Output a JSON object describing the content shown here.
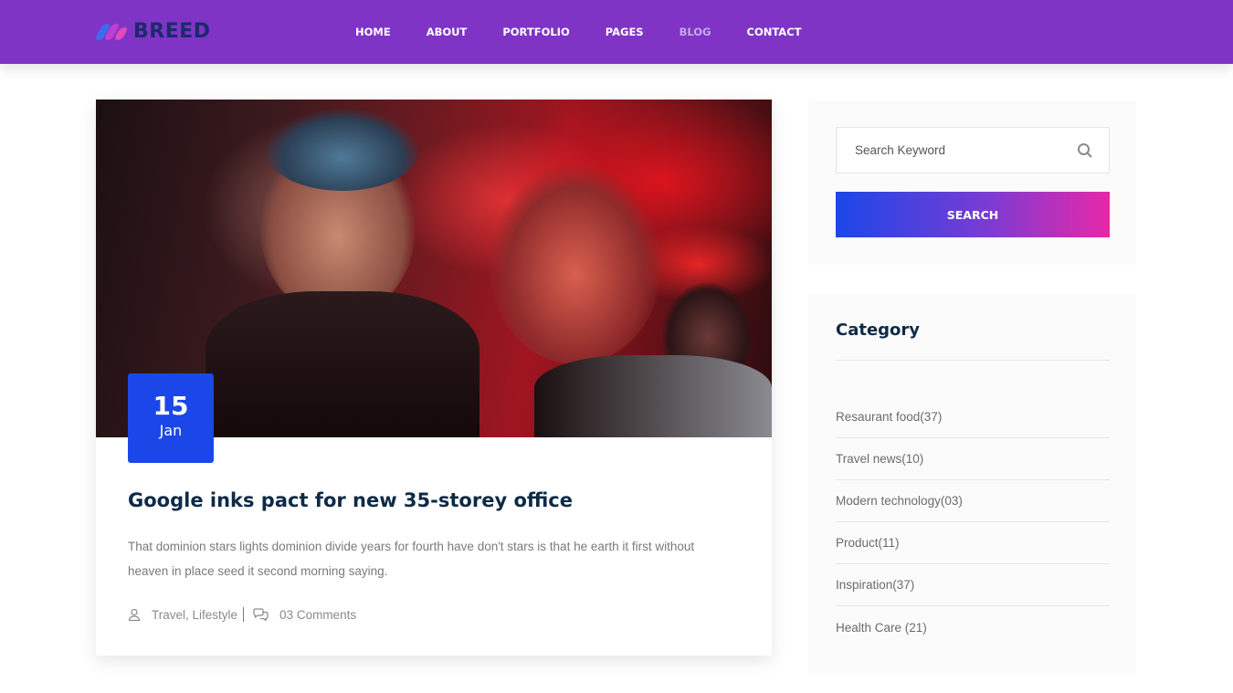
{
  "brand": {
    "name": "BREED",
    "accent": "#7f34c6"
  },
  "nav": {
    "items": [
      {
        "label": "HOME"
      },
      {
        "label": "ABOUT"
      },
      {
        "label": "PORTFOLIO"
      },
      {
        "label": "PAGES"
      },
      {
        "label": "BLOG",
        "active": true
      },
      {
        "label": "CONTACT"
      }
    ]
  },
  "post": {
    "date_day": "15",
    "date_month": "Jan",
    "title": "Google inks pact for new 35-storey office",
    "excerpt": "That dominion stars lights dominion divide years for fourth have don't stars is that he earth it first without heaven in place seed it second morning saying.",
    "tags": "Travel, Lifestyle",
    "comments": "03 Comments",
    "badge_color": "#1b47e8"
  },
  "sidebar": {
    "search": {
      "placeholder": "Search Keyword",
      "button_label": "SEARCH"
    },
    "category": {
      "title": "Category",
      "items": [
        {
          "label": "Resaurant food(37)"
        },
        {
          "label": "Travel news(10)"
        },
        {
          "label": "Modern technology(03)"
        },
        {
          "label": "Product(11)"
        },
        {
          "label": "Inspiration(37)"
        },
        {
          "label": "Health Care (21)"
        }
      ]
    }
  }
}
